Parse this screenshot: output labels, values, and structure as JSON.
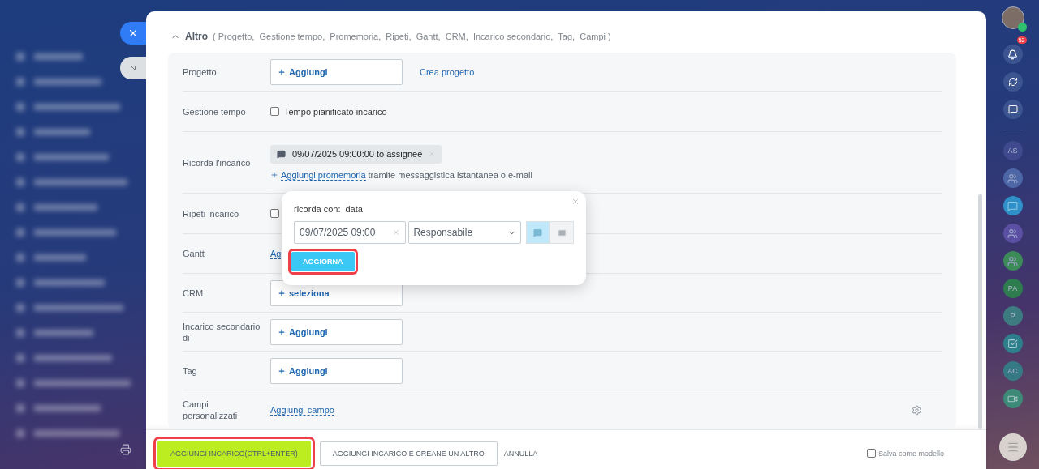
{
  "section": {
    "title": "Altro",
    "summary": "( Progetto,  Gestione tempo,  Promemoria,  Ripeti,  Gantt,  CRM,  Incarico secondario,  Tag,  Campi )",
    "expanded": true
  },
  "rows": [
    {
      "kind": "field",
      "label": "Progetto",
      "button": "Aggiungi",
      "link": "Crea progetto"
    },
    {
      "kind": "checkbox",
      "label": "Gestione tempo",
      "option": "Tempo pianificato incarico",
      "checked": false
    },
    {
      "kind": "reminder",
      "label": "Ricorda l'incarico",
      "reminders": [
        {
          "text": "09/07/2025 09:00:00 to assignee"
        }
      ],
      "add_link": "Aggiungi promemoria",
      "add_note": "tramite messaggistica istantanea o e-mail"
    },
    {
      "kind": "checkbox",
      "label": "Ripeti incarico",
      "checked": false
    },
    {
      "kind": "link",
      "label": "Gantt",
      "link": "Ag"
    },
    {
      "kind": "field",
      "label": "CRM",
      "button": "seleziona"
    },
    {
      "kind": "field",
      "label": "Incarico secondario di",
      "button": "Aggiungi"
    },
    {
      "kind": "field",
      "label": "Tag",
      "button": "Aggiungi"
    },
    {
      "kind": "link",
      "label": "Campi personalizzati",
      "link": "Aggiungi campo",
      "settings": true
    }
  ],
  "popup": {
    "label": "ricorda con:",
    "value": "data",
    "date": "09/07/2025 09:00",
    "recipient": "Responsabile",
    "channels": [
      {
        "kind": "message",
        "selected": true
      },
      {
        "kind": "email",
        "selected": false
      }
    ],
    "button": "AGGIORNA"
  },
  "footer": {
    "primary": "AGGIUNGI INCARICO(CTRL+ENTER)",
    "secondary": "AGGIUNGI INCARICO E CREANE UN ALTRO",
    "cancel": "ANNULLA",
    "template": {
      "label": "Salva come modello",
      "checked": false
    }
  },
  "right_bar": {
    "notifications": "52",
    "items": [
      {
        "kind": "initials",
        "text": "AS",
        "color": "#3f4a8e"
      },
      {
        "kind": "group",
        "color": "#4c66a6"
      },
      {
        "kind": "chat",
        "color": "#2f8fc8"
      },
      {
        "kind": "group",
        "color": "#5a4fa2"
      },
      {
        "kind": "group",
        "color": "#3b8a58"
      },
      {
        "kind": "initials",
        "text": "PA",
        "color": "#2e7d4e"
      },
      {
        "kind": "initials",
        "text": "P",
        "color": "#3d7b80"
      },
      {
        "kind": "task",
        "color": "#2d7f8c"
      },
      {
        "kind": "initials",
        "text": "AC",
        "color": "#367a85"
      },
      {
        "kind": "video",
        "color": "#3d8a78"
      }
    ]
  }
}
